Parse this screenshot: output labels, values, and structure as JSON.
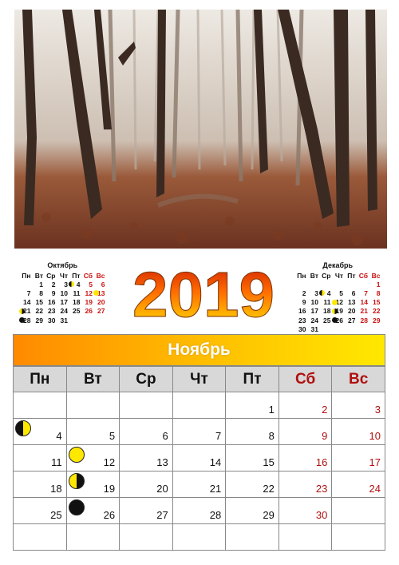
{
  "year": "2019",
  "weekdays": [
    "Пн",
    "Вт",
    "Ср",
    "Чт",
    "Пт",
    "Сб",
    "Вс"
  ],
  "colors": {
    "weekend": "#b01010",
    "month_bar_start": "#ff8a00",
    "month_bar_end": "#ffe800",
    "moon_yellow": "#ffe800"
  },
  "october": {
    "title": "Октябрь",
    "weeks": [
      [
        "",
        "1",
        "2",
        "3",
        "4",
        "5",
        "6"
      ],
      [
        "7",
        "8",
        "9",
        "10",
        "11",
        "12",
        "13"
      ],
      [
        "14",
        "15",
        "16",
        "17",
        "18",
        "19",
        "20"
      ],
      [
        "21",
        "22",
        "23",
        "24",
        "25",
        "26",
        "27"
      ],
      [
        "28",
        "29",
        "30",
        "31",
        "",
        "",
        ""
      ]
    ],
    "moons": {
      "4": "first-quarter",
      "13": "full",
      "21": "last-quarter",
      "28": "new"
    }
  },
  "december": {
    "title": "Декабрь",
    "weeks": [
      [
        "",
        "",
        "",
        "",
        "",
        "",
        "1"
      ],
      [
        "2",
        "3",
        "4",
        "5",
        "6",
        "7",
        "8"
      ],
      [
        "9",
        "10",
        "11",
        "12",
        "13",
        "14",
        "15"
      ],
      [
        "16",
        "17",
        "18",
        "19",
        "20",
        "21",
        "22"
      ],
      [
        "23",
        "24",
        "25",
        "26",
        "27",
        "28",
        "29"
      ],
      [
        "30",
        "31",
        "",
        "",
        "",
        "",
        ""
      ]
    ],
    "moons": {
      "4": "first-quarter",
      "12": "full",
      "19": "last-quarter",
      "26": "new"
    }
  },
  "november": {
    "title": "Ноябрь",
    "weeks": [
      [
        "",
        "",
        "",
        "",
        "1",
        "2",
        "3"
      ],
      [
        "4",
        "5",
        "6",
        "7",
        "8",
        "9",
        "10"
      ],
      [
        "11",
        "12",
        "13",
        "14",
        "15",
        "16",
        "17"
      ],
      [
        "18",
        "19",
        "20",
        "21",
        "22",
        "23",
        "24"
      ],
      [
        "25",
        "26",
        "27",
        "28",
        "29",
        "30",
        ""
      ],
      [
        "",
        "",
        "",
        "",
        "",
        "",
        ""
      ]
    ],
    "moons": {
      "4": "first-quarter",
      "12": "full",
      "19": "last-quarter",
      "26": "new"
    }
  }
}
